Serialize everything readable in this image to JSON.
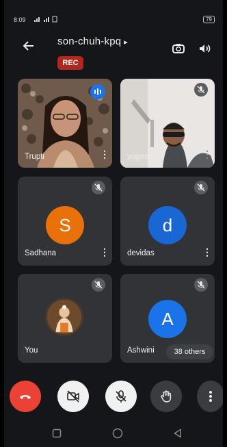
{
  "status_bar": {
    "time": "8:09",
    "battery": "79"
  },
  "meeting": {
    "code": "son-chuh-kpq",
    "rec_label": "REC"
  },
  "participants": [
    {
      "name": "Trupti"
    },
    {
      "name": "yogesh"
    },
    {
      "name": "Sadhana",
      "initial": "S"
    },
    {
      "name": "devidas",
      "initial": "d"
    },
    {
      "name": "You"
    },
    {
      "name": "Ashwini",
      "initial": "A"
    }
  ],
  "others_chip": "38 others",
  "colors": {
    "sadhana_avatar": "#e8710a",
    "devidas_avatar": "#1967d2",
    "ashwini_avatar": "#1a73e8",
    "end_call": "#ea4335",
    "rec": "#b3261e"
  }
}
